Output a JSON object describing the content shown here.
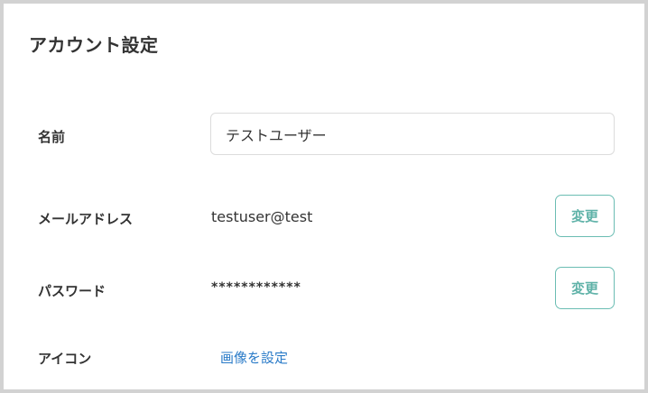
{
  "page": {
    "title": "アカウント設定"
  },
  "fields": {
    "name": {
      "label": "名前",
      "value": "テストユーザー"
    },
    "email": {
      "label": "メールアドレス",
      "value": "testuser@test",
      "button_label": "変更"
    },
    "password": {
      "label": "パスワード",
      "value": "************",
      "button_label": "変更"
    },
    "icon": {
      "label": "アイコン",
      "link_label": "画像を設定"
    }
  },
  "colors": {
    "accent": "#6bbdb3",
    "link": "#2a7bc8",
    "text": "#333333",
    "frame_border": "#d2d2d2"
  }
}
